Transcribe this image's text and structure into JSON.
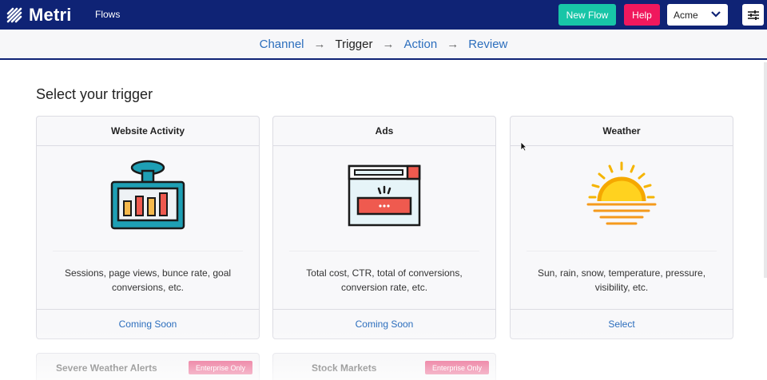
{
  "app": {
    "name": "Metri",
    "nav_flows": "Flows"
  },
  "header": {
    "new_flow": "New Flow",
    "help": "Help",
    "workspace": "Acme"
  },
  "stepper": {
    "steps": [
      "Channel",
      "Trigger",
      "Action",
      "Review"
    ],
    "active": "Trigger"
  },
  "page": {
    "title": "Select your trigger"
  },
  "cards": [
    {
      "title": "Website Activity",
      "icon": "dashboard-chart-icon",
      "description_line1": "Sessions, page views, bunce rate, goal",
      "description_line2": "conversions, etc.",
      "action": "Coming Soon"
    },
    {
      "title": "Ads",
      "icon": "browser-ad-icon",
      "description_line1": "Total cost, CTR, total of conversions,",
      "description_line2": "conversion rate, etc.",
      "action": "Coming Soon"
    },
    {
      "title": "Weather",
      "icon": "sunset-icon",
      "description_line1": "Sun, rain, snow, temperature, pressure,",
      "description_line2": "visibility, etc.",
      "action": "Select"
    }
  ],
  "more_cards": [
    {
      "title": "Severe Weather Alerts",
      "badge": "Enterprise Only"
    },
    {
      "title": "Stock Markets",
      "badge": "Enterprise Only"
    }
  ],
  "colors": {
    "navbar": "#0f2375",
    "new_flow": "#18c5a7",
    "help": "#f0185d",
    "link": "#2c6ebd",
    "badge": "#e0245e"
  }
}
